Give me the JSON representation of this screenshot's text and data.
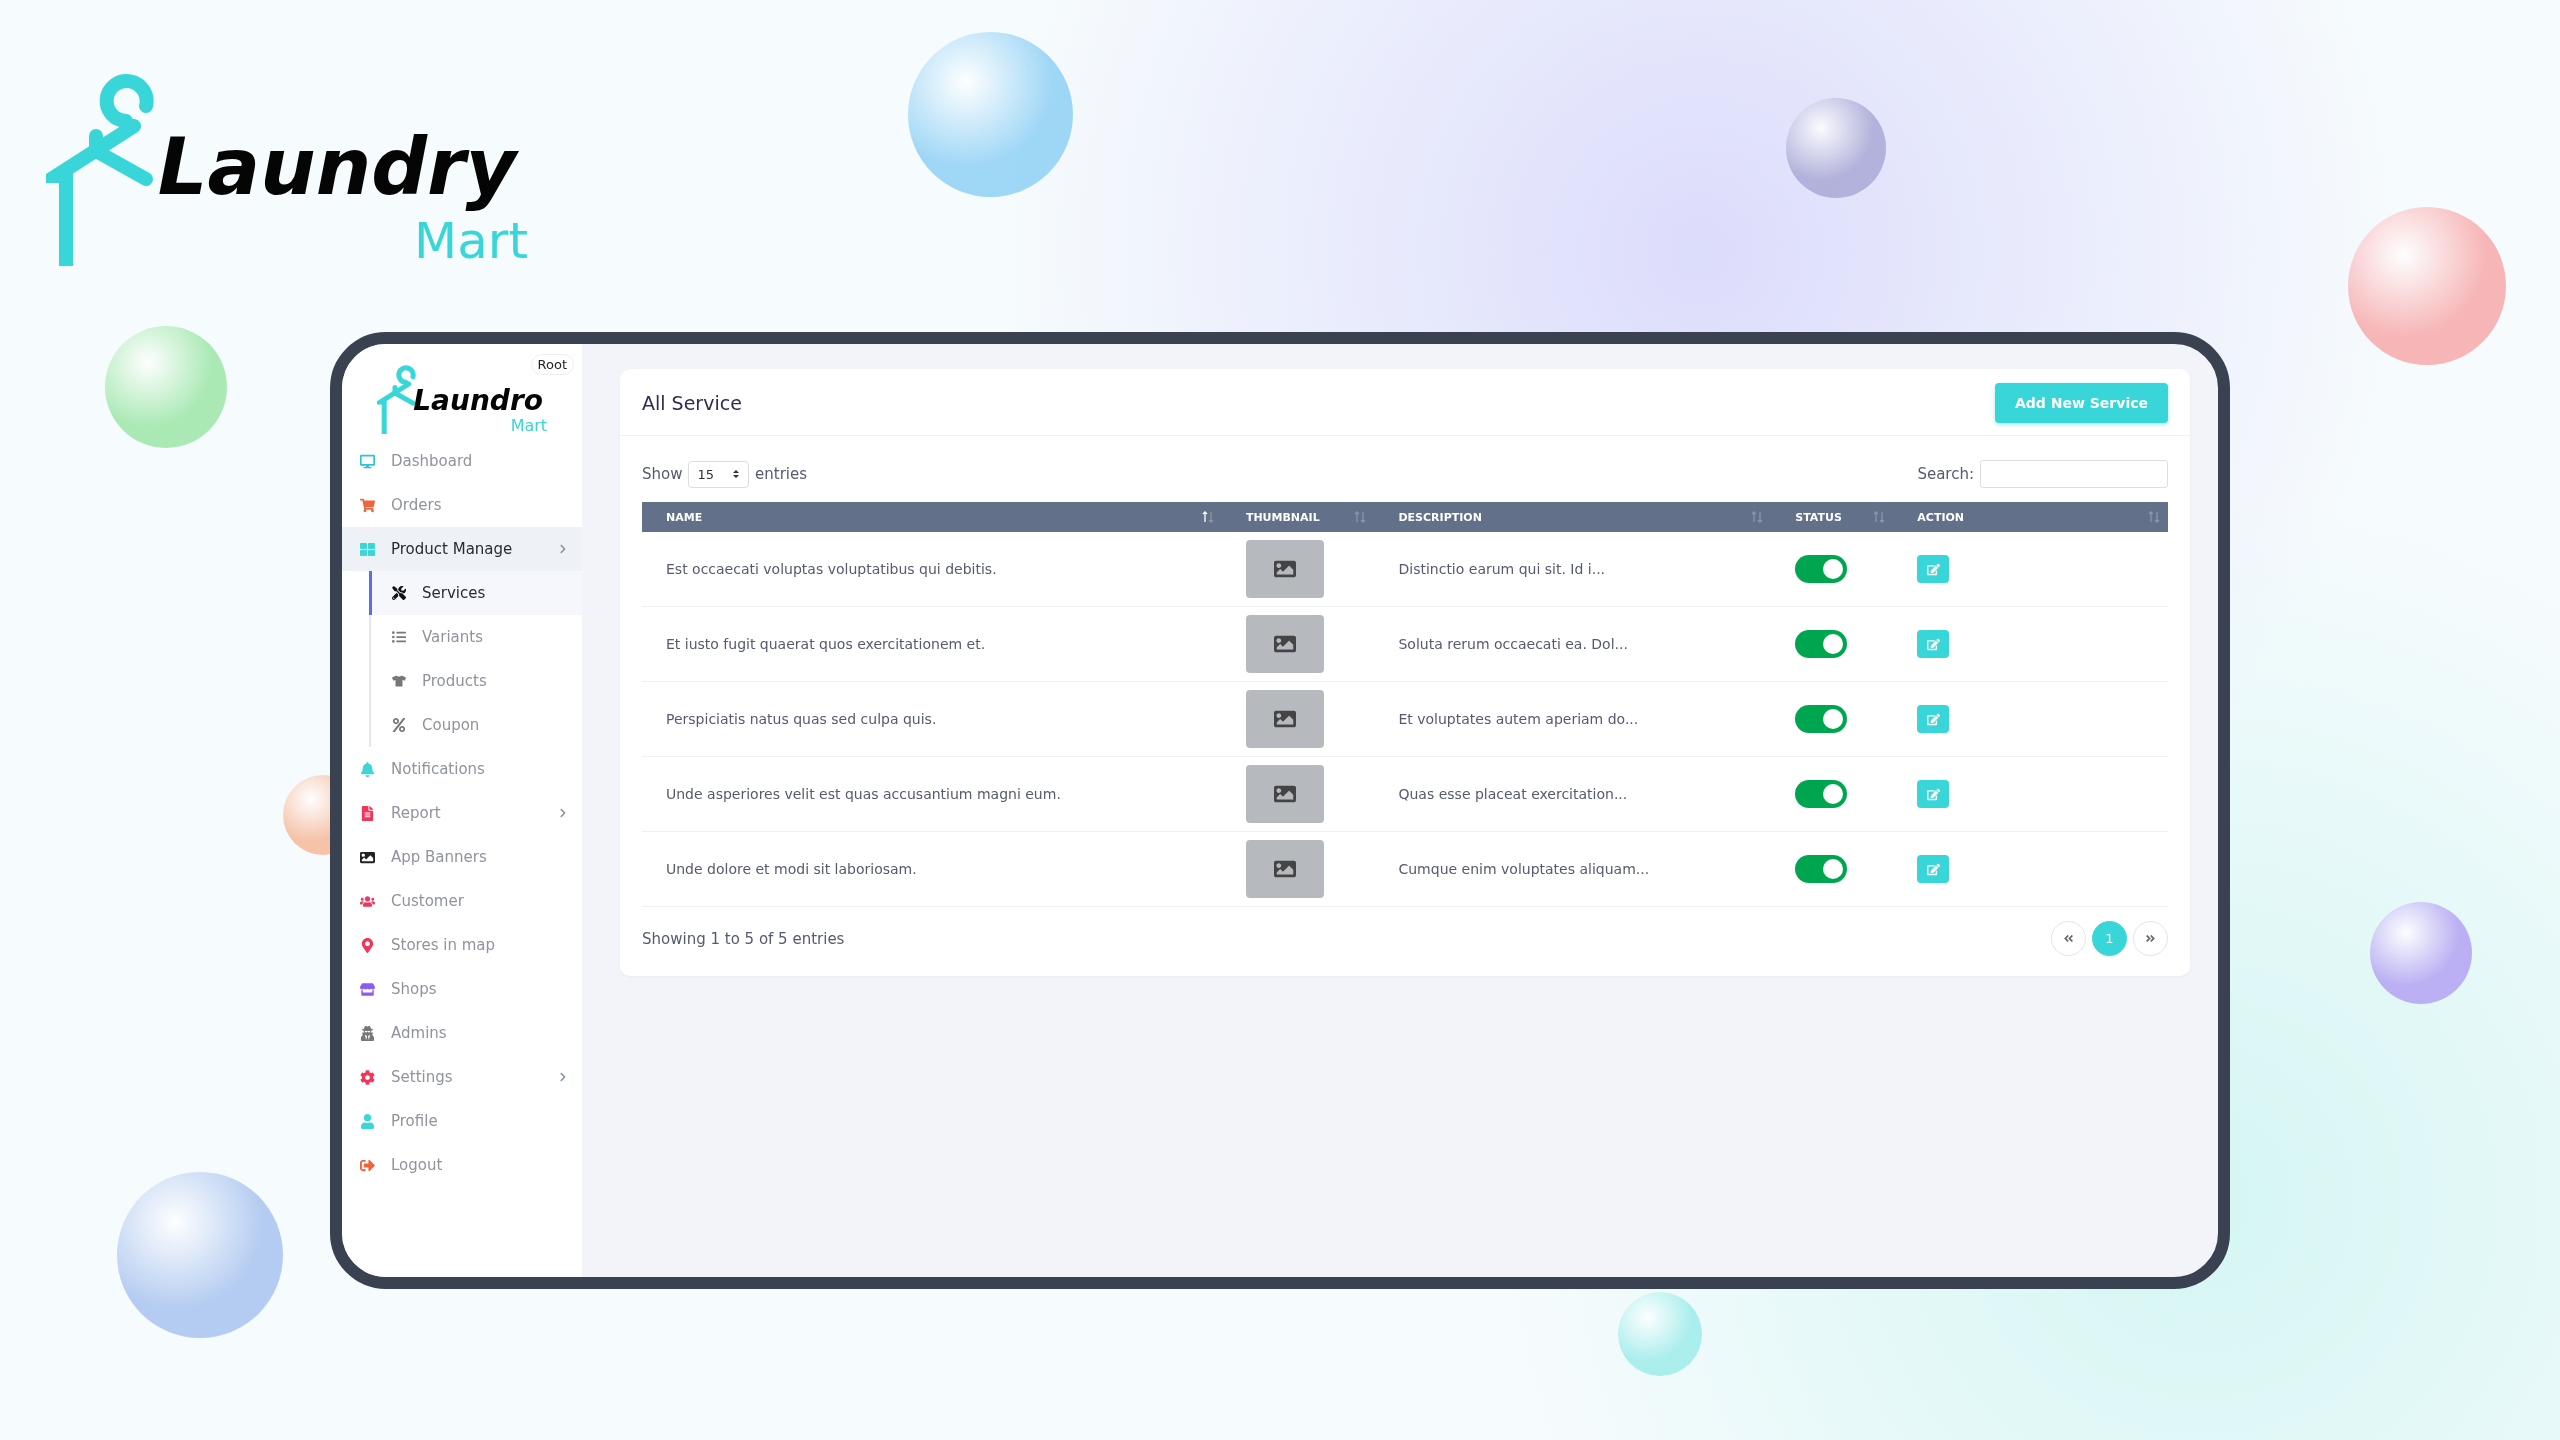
{
  "logo": {
    "word": "Laundry",
    "sub": "Mart"
  },
  "sidebar": {
    "badge": "Root",
    "logo": {
      "word": "Laundro",
      "sub": "Mart"
    },
    "items": [
      {
        "kind": "monitor",
        "label": "Dashboard",
        "color": "#2bc5d6",
        "selected": false,
        "expandable": false
      },
      {
        "kind": "cart",
        "label": "Orders",
        "color": "#f4623a",
        "selected": false,
        "expandable": false
      },
      {
        "kind": "grid",
        "label": "Product Manage",
        "color": "#3cd6d6",
        "selected": true,
        "expandable": true,
        "children": [
          {
            "kind": "tools",
            "label": "Services",
            "selected": true
          },
          {
            "kind": "list",
            "label": "Variants",
            "selected": false
          },
          {
            "kind": "shirt",
            "label": "Products",
            "selected": false
          },
          {
            "kind": "percent",
            "label": "Coupon",
            "selected": false
          }
        ]
      },
      {
        "kind": "bell",
        "label": "Notifications",
        "color": "#3cd6d6",
        "selected": false,
        "expandable": false
      },
      {
        "kind": "file",
        "label": "Report",
        "color": "#f0365c",
        "selected": false,
        "expandable": true
      },
      {
        "kind": "image",
        "label": "App Banners",
        "color": "#222222",
        "selected": false,
        "expandable": false
      },
      {
        "kind": "users",
        "label": "Customer",
        "color": "#f0365c",
        "selected": false,
        "expandable": false
      },
      {
        "kind": "pin",
        "label": "Stores in map",
        "color": "#f0365c",
        "selected": false,
        "expandable": false
      },
      {
        "kind": "store",
        "label": "Shops",
        "color": "#8a5cf0",
        "selected": false,
        "expandable": false
      },
      {
        "kind": "spy",
        "label": "Admins",
        "color": "#777777",
        "selected": false,
        "expandable": false
      },
      {
        "kind": "gear",
        "label": "Settings",
        "color": "#f0365c",
        "selected": false,
        "expandable": true
      },
      {
        "kind": "user",
        "label": "Profile",
        "color": "#3cd6d6",
        "selected": false,
        "expandable": false
      },
      {
        "kind": "logout",
        "label": "Logout",
        "color": "#f4623a",
        "selected": false,
        "expandable": false
      }
    ]
  },
  "card": {
    "title": "All Service",
    "add_button": "Add New Service",
    "show_label": "Show",
    "page_size": "15",
    "entries_label": "entries",
    "search_label": "Search:",
    "table": {
      "columns": [
        {
          "label": "NAME",
          "sorted": true
        },
        {
          "label": "THUMBNAIL",
          "sorted": false
        },
        {
          "label": "DESCRIPTION",
          "sorted": false
        },
        {
          "label": "STATUS",
          "sorted": false
        },
        {
          "label": "ACTION",
          "sorted": false
        }
      ],
      "rows": [
        {
          "name": "Est occaecati voluptas voluptatibus qui debitis.",
          "description": "Distinctio earum qui sit. Id i...",
          "on": true
        },
        {
          "name": "Et iusto fugit quaerat quos exercitationem et.",
          "description": "Soluta rerum occaecati ea. Dol...",
          "on": true
        },
        {
          "name": "Perspiciatis natus quas sed culpa quis.",
          "description": "Et voluptates autem aperiam do...",
          "on": true
        },
        {
          "name": "Unde asperiores velit est quas accusantium magni eum.",
          "description": "Quas esse placeat exercitation...",
          "on": true
        },
        {
          "name": "Unde dolore et modi sit laboriosam.",
          "description": "Cumque enim voluptates aliquam...",
          "on": true
        }
      ]
    },
    "footer": "Showing 1 to 5 of 5 entries",
    "pages": [
      {
        "label": "1",
        "selected": true
      }
    ]
  }
}
